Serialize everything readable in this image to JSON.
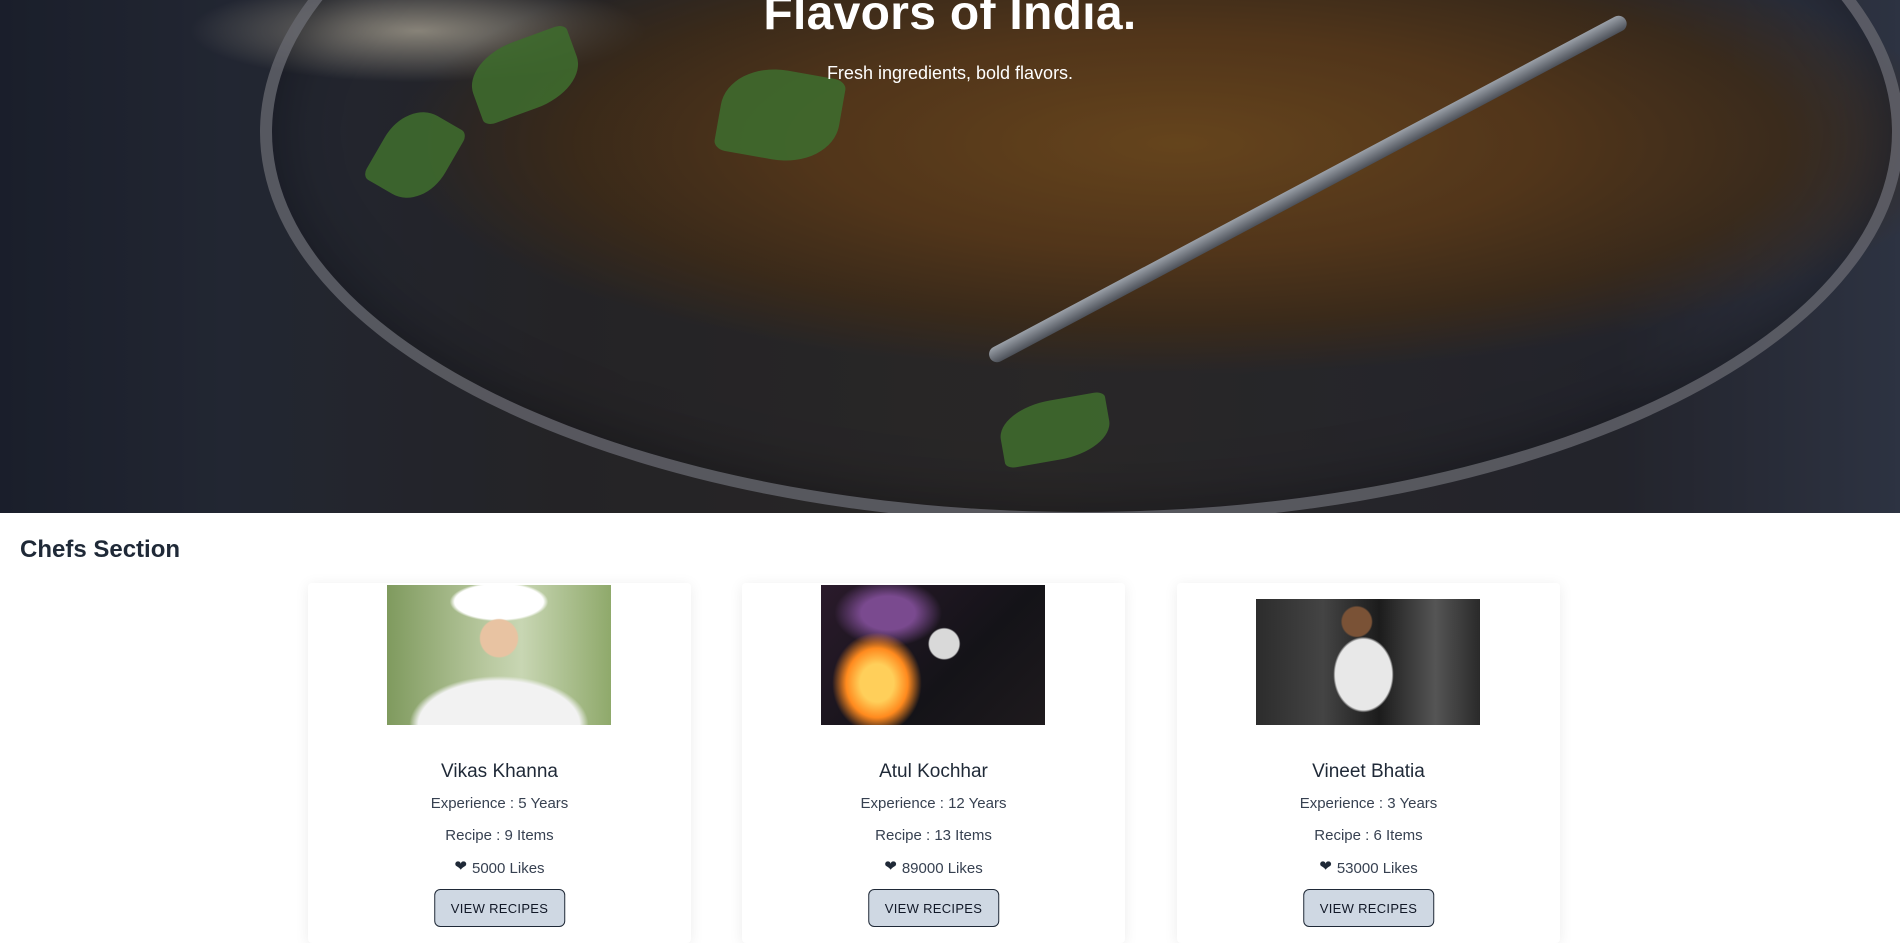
{
  "hero": {
    "title": "Flavors of India.",
    "subtitle": "Fresh ingredients, bold flavors."
  },
  "section": {
    "title": "Chefs Section"
  },
  "chefs": [
    {
      "name": "Vikas Khanna",
      "experience": "Experience : 5 Years",
      "recipes": "Recipe : 9 Items",
      "likes": "5000 Likes",
      "button": "VIEW RECIPES",
      "icon": "heart-icon"
    },
    {
      "name": "Atul Kochhar",
      "experience": "Experience : 12 Years",
      "recipes": "Recipe : 13 Items",
      "likes": "89000 Likes",
      "button": "VIEW RECIPES",
      "icon": "heart-icon"
    },
    {
      "name": "Vineet Bhatia",
      "experience": "Experience : 3 Years",
      "recipes": "Recipe : 6 Items",
      "likes": "53000 Likes",
      "button": "VIEW RECIPES",
      "icon": "heart-icon"
    }
  ],
  "colors": {
    "text": "#1f2937",
    "button_bg": "#cfd8e3",
    "hero_overlay": "#141623"
  }
}
